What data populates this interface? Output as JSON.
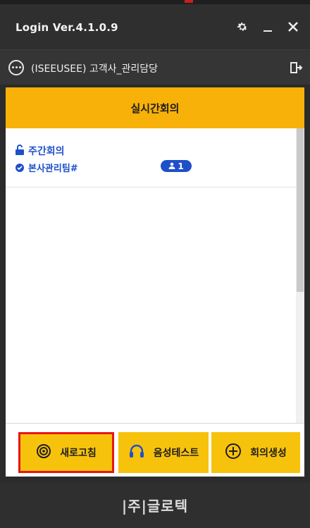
{
  "titlebar": {
    "title": "Login Ver.4.1.0.9",
    "icons": [
      "gear-icon",
      "minimize-icon",
      "close-icon"
    ]
  },
  "userbar": {
    "user_text": "(ISEEUSEE) 고객사_관리담당",
    "icons": [
      "more-icon",
      "exit-door-icon"
    ]
  },
  "tab": {
    "label": "실시간회의"
  },
  "meetings": [
    {
      "title": "주간회의",
      "team": "본사관리팀#",
      "participants": "1",
      "icons": [
        "lock-open-icon",
        "check-circle-icon",
        "person-icon"
      ]
    }
  ],
  "buttons": {
    "refresh": "새로고침",
    "voice_test": "음성테스트",
    "create_meeting": "회의생성"
  },
  "footer": {
    "brand": "|주|글로텍"
  },
  "colors": {
    "accent": "#f7b108",
    "button": "#f7c20c",
    "link_blue": "#1e50c9",
    "highlight_red": "#e81414",
    "dark_bg": "#2f2f2f"
  }
}
